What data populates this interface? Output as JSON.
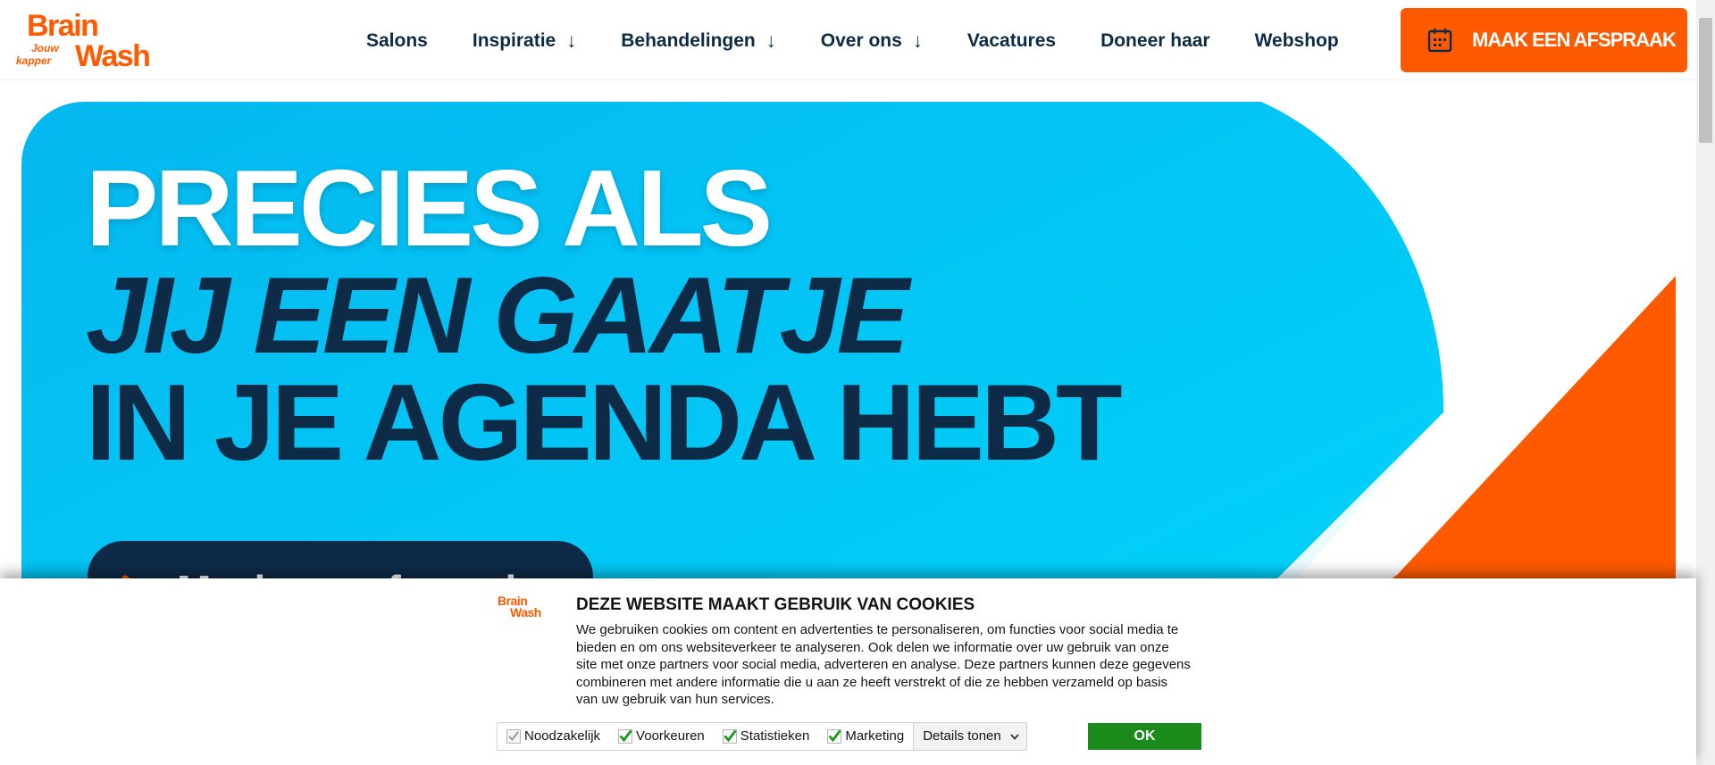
{
  "logo": {
    "line1": "Brain",
    "tag1": "Jouw",
    "tag2": "kapper",
    "line2": "Wash"
  },
  "nav": {
    "items": [
      {
        "label": "Salons",
        "has_dropdown": false
      },
      {
        "label": "Inspiratie",
        "has_dropdown": true
      },
      {
        "label": "Behandelingen",
        "has_dropdown": true
      },
      {
        "label": "Over ons",
        "has_dropdown": true
      },
      {
        "label": "Vacatures",
        "has_dropdown": false
      },
      {
        "label": "Doneer haar",
        "has_dropdown": false
      },
      {
        "label": "Webshop",
        "has_dropdown": false
      }
    ],
    "dropdown_arrow": "↓"
  },
  "cta": {
    "label": "MAAK EEN AFSPRAAK",
    "icon": "calendar-icon"
  },
  "hero": {
    "line1": "PRECIES ALS",
    "line2": "JIJ EEN GAATJE",
    "line3": "IN JE AGENDA HEBT",
    "button_label": "Maak een afspraak"
  },
  "cookie": {
    "logo_line1": "Brain",
    "logo_line2": "Wash",
    "title": "DEZE WEBSITE MAAKT GEBRUIK VAN COOKIES",
    "text": "We gebruiken cookies om content en advertenties te personaliseren, om functies voor social media te bieden en om ons websiteverkeer te analyseren. Ook delen we informatie over uw gebruik van onze site met onze partners voor social media, adverteren en analyse. Deze partners kunnen deze gegevens combineren met andere informatie die u aan ze heeft verstrekt of die ze hebben verzameld op basis van uw gebruik van hun services.",
    "options": [
      {
        "label": "Noodzakelijk",
        "checked": true,
        "disabled": true
      },
      {
        "label": "Voorkeuren",
        "checked": true,
        "disabled": false
      },
      {
        "label": "Statistieken",
        "checked": true,
        "disabled": false
      },
      {
        "label": "Marketing",
        "checked": true,
        "disabled": false
      }
    ],
    "details_label": "Details tonen",
    "ok_label": "OK"
  },
  "colors": {
    "brand_orange": "#ff5a00",
    "navy": "#0d2a47",
    "hero_cyan": "#00c8f5",
    "ok_green": "#1a8a1a",
    "check_green": "#1a9a1a"
  }
}
